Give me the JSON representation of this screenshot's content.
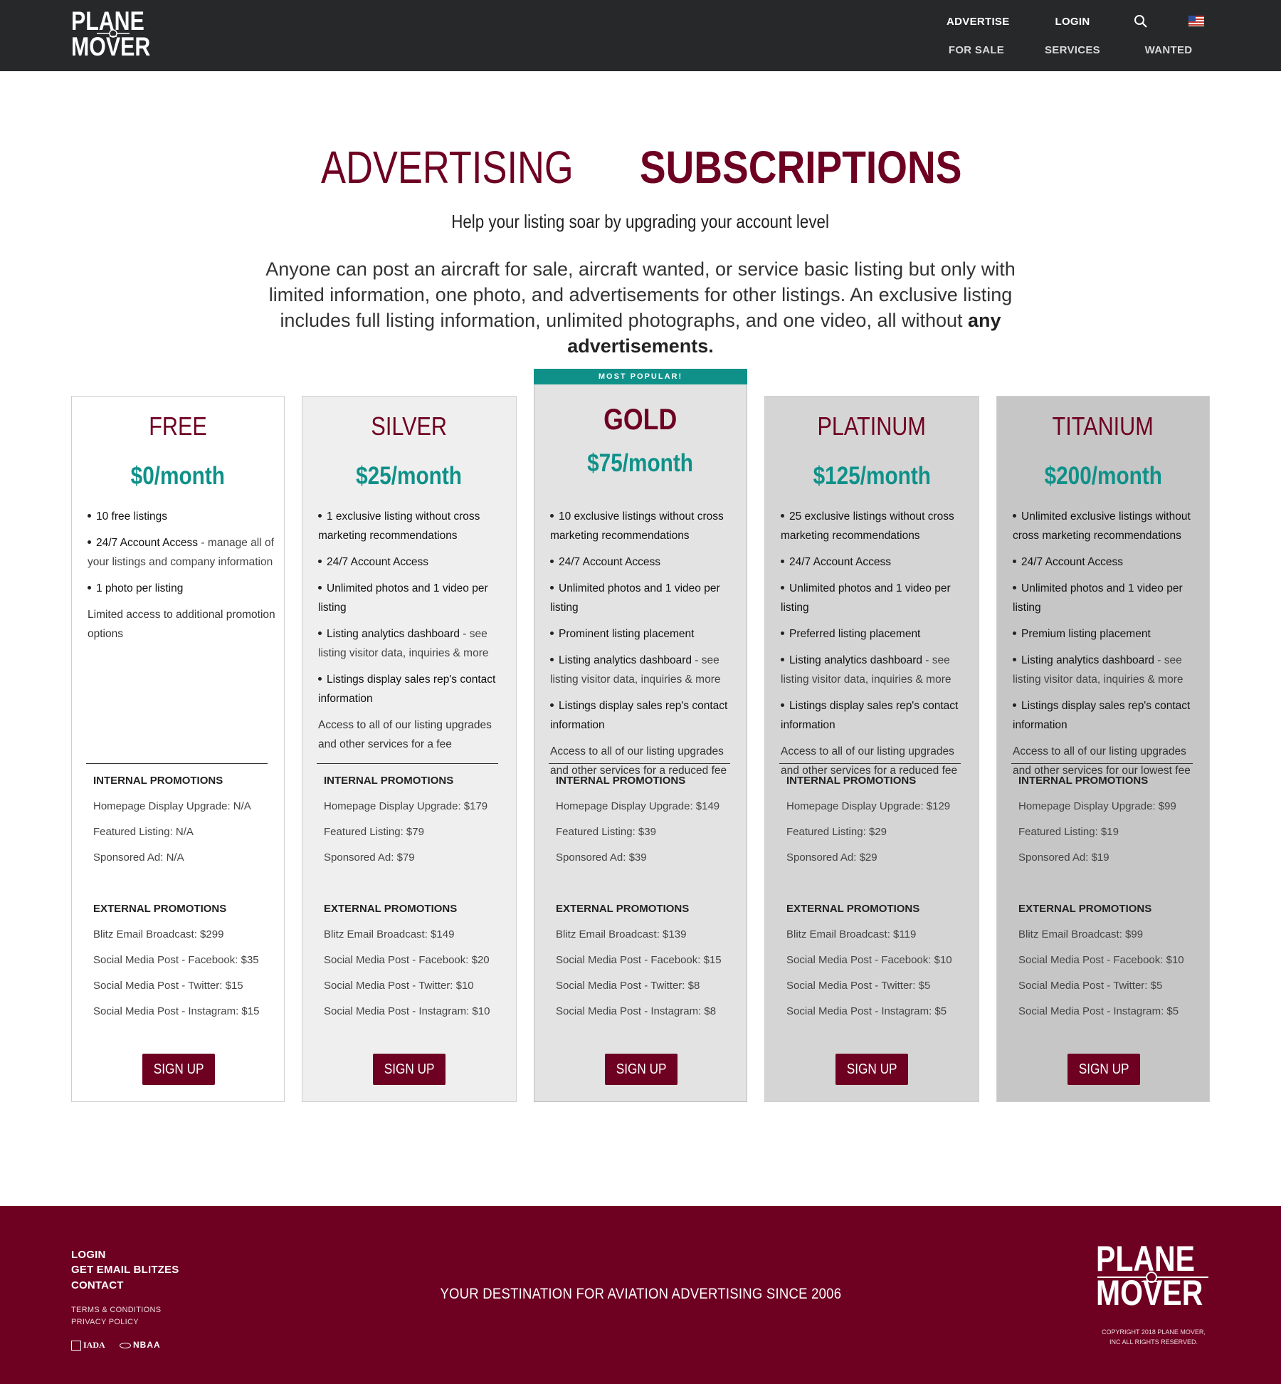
{
  "header": {
    "logo_line1": "PLANE",
    "logo_line2": "MOVER",
    "nav_top": [
      "ADVERTISE",
      "LOGIN"
    ],
    "nav_bottom": [
      "FOR SALE",
      "SERVICES",
      "WANTED"
    ],
    "icons": [
      "search-icon",
      "us-flag-icon"
    ]
  },
  "hero": {
    "title_light": "ADVERTISING",
    "title_bold": "SUBSCRIPTIONS",
    "subtitle": "Help your listing soar by upgrading your account level",
    "description": "Anyone can post an aircraft for sale, aircraft wanted, or service basic listing but only with limited information, one photo, and advertisements for other listings.  An exclusive listing includes full listing information, unlimited photographs, and one video, all without",
    "description_bold": "any advertisements."
  },
  "colors": {
    "brand": "#6e0022",
    "accent": "#0f9189",
    "header_bg": "#262829"
  },
  "plans": [
    {
      "name": "FREE",
      "price": "$0/month",
      "features": [
        {
          "strong": "10 free listings",
          "rest": ""
        },
        {
          "strong": "24/7 Account Access",
          "rest": " - manage all of your listings and company information"
        },
        {
          "strong": "1 photo per listing",
          "rest": ""
        }
      ],
      "note": "Limited access to additional promotion options",
      "internal_heading": "INTERNAL PROMOTIONS",
      "internal": [
        "Homepage Display Upgrade: N/A",
        "Featured Listing: N/A",
        "Sponsored Ad: N/A"
      ],
      "external_heading": "EXTERNAL PROMOTIONS",
      "external": [
        "Blitz Email Broadcast: $299",
        "Social Media Post - Facebook: $35",
        "Social Media Post - Twitter: $15",
        "Social Media Post - Instagram: $15"
      ],
      "signup": "SIGN UP"
    },
    {
      "name": "SILVER",
      "price": "$25/month",
      "features": [
        {
          "strong": "1 exclusive listing without cross marketing recommendations",
          "rest": ""
        },
        {
          "strong": "24/7 Account Access",
          "rest": ""
        },
        {
          "strong": "Unlimited photos and 1 video per listing",
          "rest": ""
        },
        {
          "strong": "Listing analytics dashboard",
          "rest": " - see listing visitor data, inquiries & more"
        },
        {
          "strong": "Listings display sales rep's contact information",
          "rest": ""
        }
      ],
      "note": "Access to all of our listing upgrades and other services for a fee",
      "internal_heading": "INTERNAL PROMOTIONS",
      "internal": [
        "Homepage Display Upgrade: $179",
        "Featured Listing: $79",
        "Sponsored Ad: $79"
      ],
      "external_heading": "EXTERNAL PROMOTIONS",
      "external": [
        "Blitz Email Broadcast: $149",
        "Social Media Post - Facebook: $20",
        "Social Media Post - Twitter: $10",
        "Social Media Post - Instagram: $10"
      ],
      "signup": "SIGN UP"
    },
    {
      "badge": "MOST POPULAR!",
      "name": "GOLD",
      "price": "$75/month",
      "features": [
        {
          "strong": "10 exclusive listings without cross marketing recommendations",
          "rest": ""
        },
        {
          "strong": "24/7 Account Access",
          "rest": ""
        },
        {
          "strong": "Unlimited photos and 1 video per listing",
          "rest": ""
        },
        {
          "strong": "Prominent listing placement",
          "rest": ""
        },
        {
          "strong": "Listing analytics dashboard",
          "rest": " - see listing visitor data, inquiries & more"
        },
        {
          "strong": "Listings display sales rep's contact information",
          "rest": ""
        }
      ],
      "note": "Access to all of our listing upgrades and other services for a reduced fee",
      "internal_heading": "INTERNAL PROMOTIONS",
      "internal": [
        "Homepage Display Upgrade: $149",
        "Featured Listing: $39",
        "Sponsored Ad: $39"
      ],
      "external_heading": "EXTERNAL PROMOTIONS",
      "external": [
        "Blitz Email Broadcast: $139",
        "Social Media Post - Facebook: $15",
        "Social Media Post - Twitter: $8",
        "Social Media Post - Instagram: $8"
      ],
      "signup": "SIGN UP"
    },
    {
      "name": "PLATINUM",
      "price": "$125/month",
      "features": [
        {
          "strong": "25 exclusive listings without cross marketing recommendations",
          "rest": ""
        },
        {
          "strong": "24/7 Account Access",
          "rest": ""
        },
        {
          "strong": "Unlimited photos and 1 video per listing",
          "rest": ""
        },
        {
          "strong": "Preferred listing placement",
          "rest": ""
        },
        {
          "strong": "Listing analytics dashboard",
          "rest": " - see listing visitor data, inquiries & more"
        },
        {
          "strong": "Listings display sales rep's contact information",
          "rest": ""
        }
      ],
      "note": "Access to all of our listing upgrades and other services for a reduced fee",
      "internal_heading": "INTERNAL PROMOTIONS",
      "internal": [
        "Homepage Display Upgrade: $129",
        "Featured Listing: $29",
        "Sponsored Ad: $29"
      ],
      "external_heading": "EXTERNAL PROMOTIONS",
      "external": [
        "Blitz Email Broadcast: $119",
        "Social Media Post - Facebook: $10",
        "Social Media Post - Twitter: $5",
        "Social Media Post - Instagram: $5"
      ],
      "signup": "SIGN UP"
    },
    {
      "name": "TITANIUM",
      "price": "$200/month",
      "features": [
        {
          "strong": "Unlimited exclusive listings without cross marketing recommendations",
          "rest": ""
        },
        {
          "strong": "24/7 Account Access",
          "rest": ""
        },
        {
          "strong": "Unlimited photos and 1 video per listing",
          "rest": ""
        },
        {
          "strong": "Premium listing placement",
          "rest": ""
        },
        {
          "strong": "Listing analytics dashboard",
          "rest": " - see listing visitor data, inquiries & more"
        },
        {
          "strong": "Listings display sales rep's contact information",
          "rest": ""
        }
      ],
      "note": "Access to all of our listing upgrades and other services for our lowest fee",
      "internal_heading": "INTERNAL PROMOTIONS",
      "internal": [
        "Homepage Display Upgrade: $99",
        "Featured Listing: $19",
        "Sponsored Ad: $19"
      ],
      "external_heading": "EXTERNAL PROMOTIONS",
      "external": [
        "Blitz Email Broadcast: $99",
        "Social Media Post - Facebook: $10",
        "Social Media Post - Twitter: $5",
        "Social Media Post - Instagram: $5"
      ],
      "signup": "SIGN UP"
    }
  ],
  "footer": {
    "links": [
      "LOGIN",
      "GET EMAIL BLITZES",
      "CONTACT"
    ],
    "small_links": [
      "TERMS & CONDITIONS",
      "PRIVACY POLICY"
    ],
    "tagline": "YOUR DESTINATION FOR AVIATION ADVERTISING SINCE 2006",
    "logo_line1": "PLANE",
    "logo_line2": "MOVER",
    "copyright_line1": "COPYRIGHT 2018 PLANE MOVER,",
    "copyright_line2": "INC ALL RIGHTS RESERVED.",
    "assoc": [
      "IADA",
      "NBAA"
    ]
  }
}
